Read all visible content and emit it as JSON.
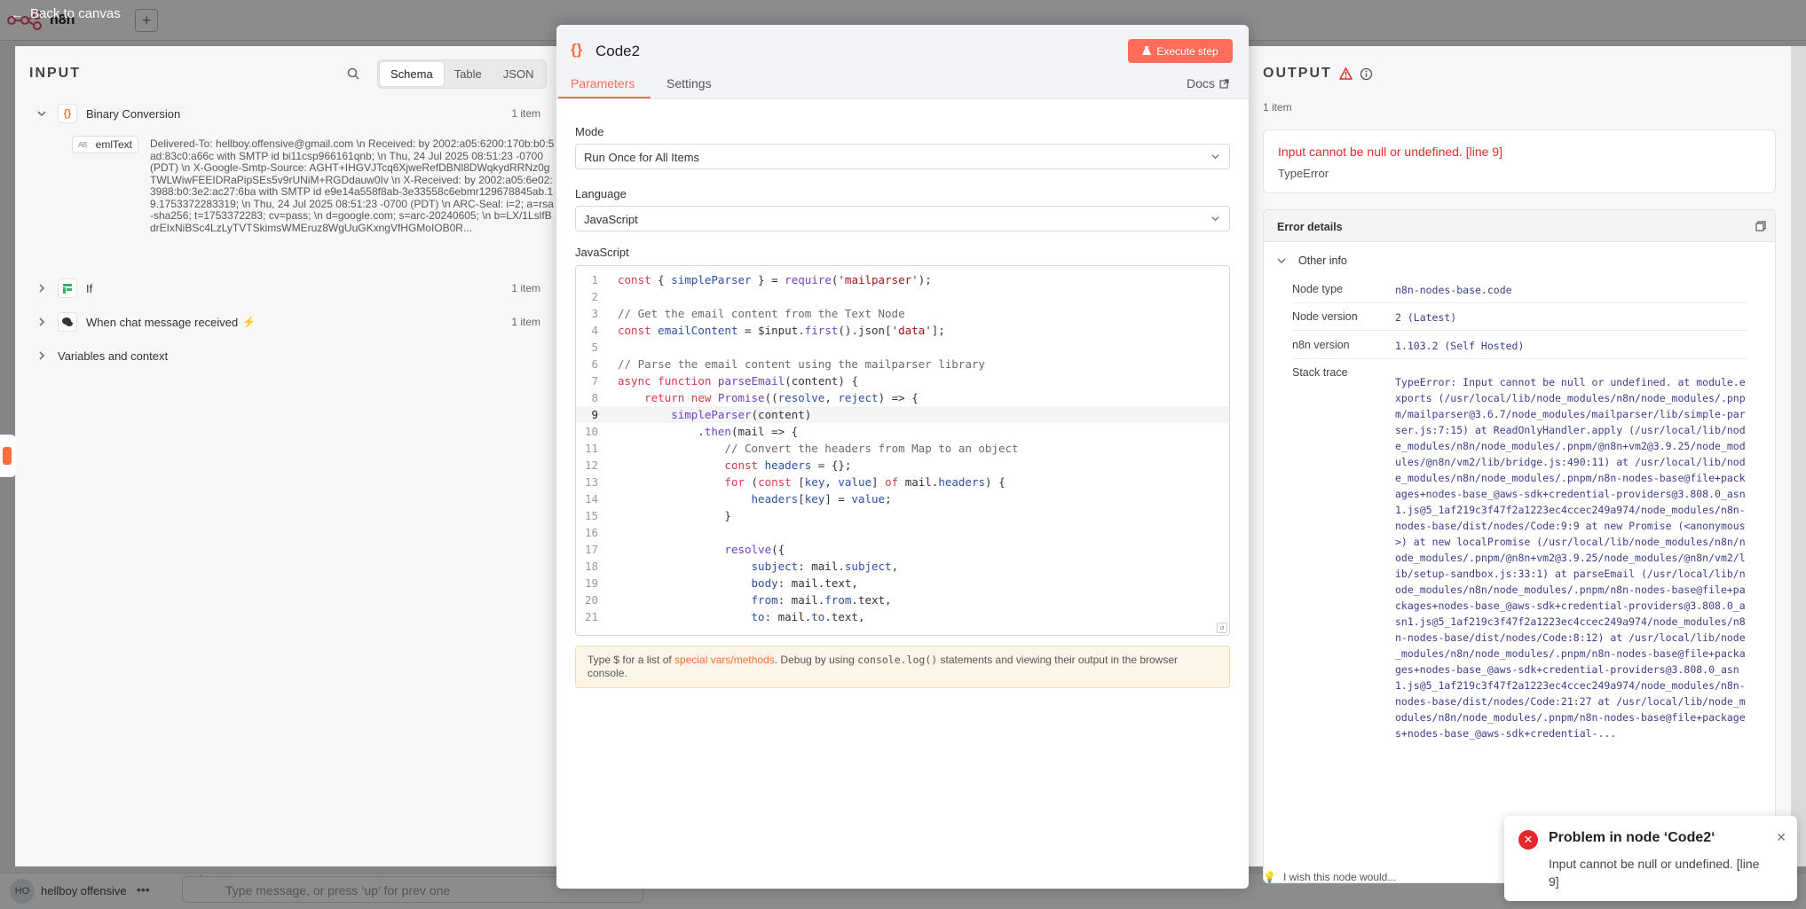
{
  "header": {
    "back_label": "Back to canvas",
    "app_name": "n8n"
  },
  "input": {
    "title": "INPUT",
    "view_tabs": [
      "Schema",
      "Table",
      "JSON"
    ],
    "active_view": "Schema",
    "nodes": [
      {
        "label": "Binary Conversion",
        "count": "1 item",
        "expanded": true
      },
      {
        "label": "If",
        "count": "1 item",
        "expanded": false
      },
      {
        "label": "When chat message received",
        "count": "1 item",
        "expanded": false
      },
      {
        "label": "Variables and context",
        "count": "",
        "expanded": false
      }
    ],
    "field_name": "emlText",
    "field_value": "Delivered-To: hellboy.offensive@gmail.com \\n Received: by 2002:a05:6200:170b:b0:5ad:83c0:a66c with SMTP id bi11csp966161qnb; \\n Thu, 24 Jul 2025 08:51:23 -0700 (PDT) \\n X-Google-Smtp-Source: AGHT+IHGVJTcq6XjweRefDBNl8DWqkydRRNz0gTWLWiwFEEIDRaPipSEs5v9rUNiM+RGDdauw0Iv \\n X-Received: by 2002:a05:6e02:3988:b0:3e2:ac27:6ba with SMTP id e9e14a558f8ab-3e33558c6ebmr129678845ab.19.1753372283319; \\n Thu, 24 Jul 2025 08:51:23 -0700 (PDT) \\n ARC-Seal: i=2; a=rsa-sha256; t=1753372283; cv=pass; \\n d=google.com; s=arc-20240605; \\n b=LX/1LslfBdrEIxNiBSc4LzLyTVTSkimsWMEruz8WgUuGKxngVfHGMoIOB0R..."
  },
  "node": {
    "name": "Code2",
    "execute_label": "Execute step",
    "tabs": [
      "Parameters",
      "Settings"
    ],
    "docs_label": "Docs",
    "mode_label": "Mode",
    "mode_value": "Run Once for All Items",
    "language_label": "Language",
    "language_value": "JavaScript",
    "editor_label": "JavaScript",
    "hint_prefix": "Type $ for a list of ",
    "hint_link": "special vars/methods",
    "hint_mid": ". Debug by using ",
    "hint_code": "console.log()",
    "hint_suffix": " statements and viewing their output in the browser console."
  },
  "code_lines": [
    "const { simpleParser } = require('mailparser');",
    "",
    "// Get the email content from the Text Node",
    "const emailContent = $input.first().json['data'];",
    "",
    "// Parse the email content using the mailparser library",
    "async function parseEmail(content) {",
    "    return new Promise((resolve, reject) => {",
    "        simpleParser(content)",
    "            .then(mail => {",
    "                // Convert the headers from Map to an object",
    "                const headers = {};",
    "                for (const [key, value] of mail.headers) {",
    "                    headers[key] = value;",
    "                }",
    "",
    "                resolve({",
    "                    subject: mail.subject,",
    "                    body: mail.text,",
    "                    from: mail.from.text,",
    "                    to: mail.to.text,"
  ],
  "active_line": 9,
  "output": {
    "title": "OUTPUT",
    "count": "1 item",
    "error_message": "Input cannot be null or undefined. [line 9]",
    "error_type": "TypeError",
    "details_title": "Error details",
    "other_info_label": "Other info",
    "kv": [
      {
        "key": "Node type",
        "value": "n8n-nodes-base.code"
      },
      {
        "key": "Node version",
        "value": "2 (Latest)"
      },
      {
        "key": "n8n version",
        "value": "1.103.2 (Self Hosted)"
      },
      {
        "key": "Stack trace",
        "value": ""
      }
    ],
    "stack_trace": "TypeError: Input cannot be null or undefined. at module.exports (/usr/local/lib/node_modules/n8n/node_modules/.pnpm/mailparser@3.6.7/node_modules/mailparser/lib/simple-parser.js:7:15) at ReadOnlyHandler.apply (/usr/local/lib/node_modules/n8n/node_modules/.pnpm/@n8n+vm2@3.9.25/node_modules/@n8n/vm2/lib/bridge.js:490:11) at /usr/local/lib/node_modules/n8n/node_modules/.pnpm/n8n-nodes-base@file+packages+nodes-base_@aws-sdk+credential-providers@3.808.0_asn1.js@5_1af219c3f47f2a1223ec4ccec249a974/node_modules/n8n-nodes-base/dist/nodes/Code:9:9 at new Promise (<anonymous>) at new localPromise (/usr/local/lib/node_modules/n8n/node_modules/.pnpm/@n8n+vm2@3.9.25/node_modules/@n8n/vm2/lib/setup-sandbox.js:33:1) at parseEmail (/usr/local/lib/node_modules/n8n/node_modules/.pnpm/n8n-nodes-base@file+packages+nodes-base_@aws-sdk+credential-providers@3.808.0_asn1.js@5_1af219c3f47f2a1223ec4ccec249a974/node_modules/n8n-nodes-base/dist/nodes/Code:8:12) at /usr/local/lib/node_modules/n8n/node_modules/.pnpm/n8n-nodes-base@file+packages+nodes-base_@aws-sdk+credential-providers@3.808.0_asn1.js@5_1af219c3f47f2a1223ec4ccec249a974/node_modules/n8n-nodes-base/dist/nodes/Code:21:27 at /usr/local/lib/node_modules/n8n/node_modules/.pnpm/n8n-nodes-base@file+packages+nodes-base_@aws-sdk+credential-..."
  },
  "toast": {
    "title": "Problem in node ‘Code2‘",
    "body": "Input cannot be null or undefined. [line 9]"
  },
  "footer": {
    "user_initials": "HO",
    "user_name": "hellboy offensive",
    "chat_placeholder": "Type message, or press ‘up’ for prev one",
    "wish_label": "I wish this node would..."
  },
  "colors": {
    "accent": "#ff6d5a",
    "error": "#e02d2d"
  }
}
